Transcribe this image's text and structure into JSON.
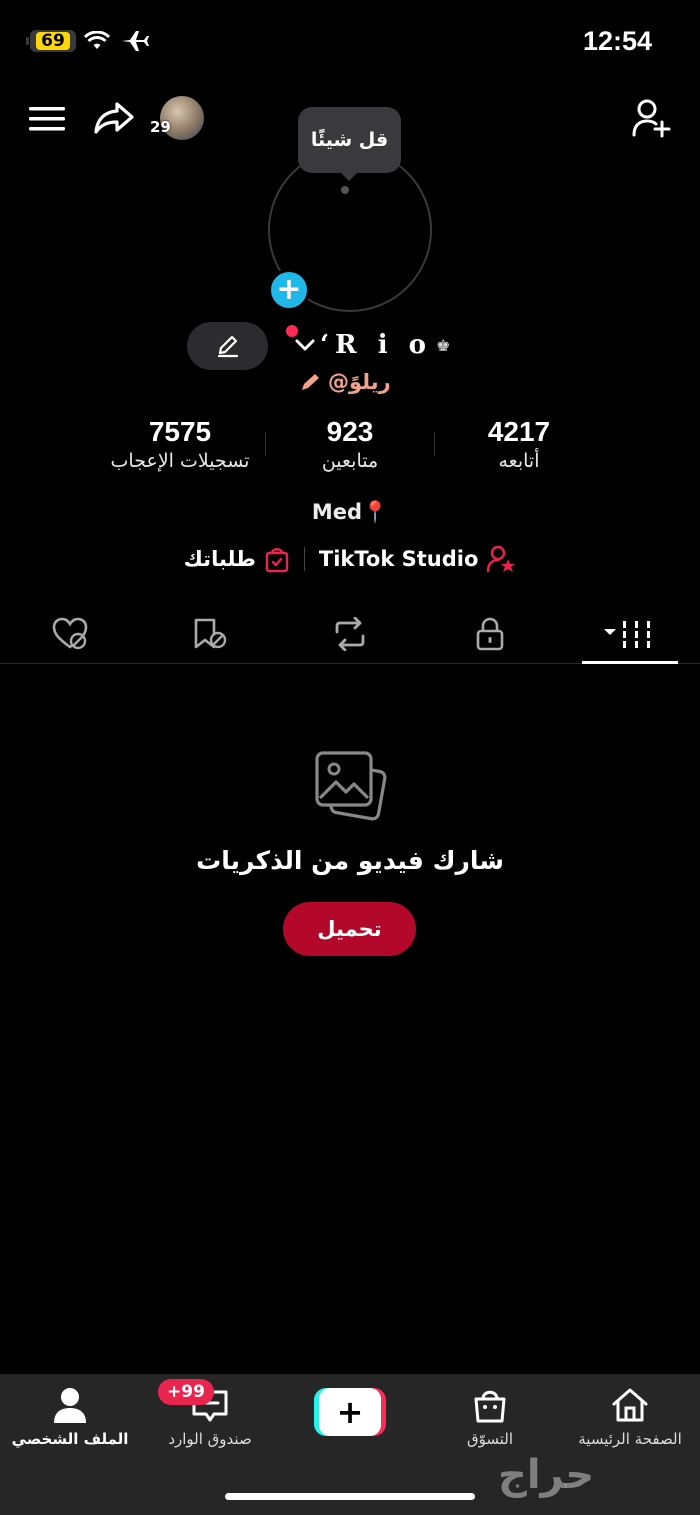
{
  "status_bar": {
    "battery": "69",
    "time": "12:54"
  },
  "header": {
    "friends_count": "29"
  },
  "profile": {
    "bubble_text": "قل شيئًا",
    "name": "‘R i o",
    "handle": "@ريلوً",
    "stats": [
      {
        "value": "4217",
        "label": "أتابعه"
      },
      {
        "value": "923",
        "label": "متابعين"
      },
      {
        "value": "7575",
        "label": "تسجيلات الإعجاب"
      }
    ],
    "bio": "Med📍",
    "links": {
      "studio": "TikTok Studio",
      "orders": "طلباتك"
    }
  },
  "empty_state": {
    "title": "شارك فيديو من الذكريات",
    "button": "تحميل"
  },
  "bottom_nav": {
    "home": "الصفحة الرئيسية",
    "shop": "التسوّق",
    "inbox": "صندوق الوارد",
    "inbox_badge": "+99",
    "profile": "الملف الشخصي"
  },
  "watermark": "حراج",
  "colors": {
    "accent": "#fe2c55",
    "upload": "#b4082b",
    "add_avatar": "#20b8e8",
    "battery": "#ffd60a"
  }
}
